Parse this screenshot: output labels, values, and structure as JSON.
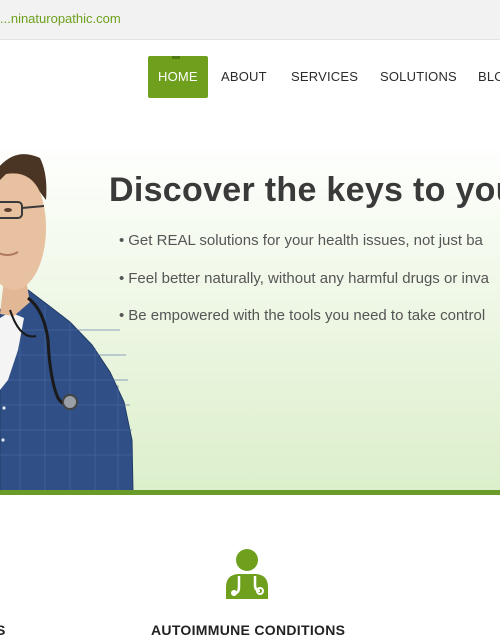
{
  "site": {
    "domain": "...ninaturopathic.com"
  },
  "nav": {
    "items": [
      {
        "label": "HOME"
      },
      {
        "label": "ABOUT"
      },
      {
        "label": "SERVICES"
      },
      {
        "label": "SOLUTIONS"
      },
      {
        "label": "BLO"
      }
    ]
  },
  "hero": {
    "title": "Discover the keys to you",
    "bullets": [
      "Get REAL solutions for your health issues, not just ba",
      "Feel better naturally, without any harmful drugs or inva",
      "Be empowered with the tools you need to take control"
    ],
    "bullet_char": "•"
  },
  "features": {
    "items": [
      {
        "title": "S"
      },
      {
        "title": "AUTOIMMUNE CONDITIONS",
        "icon": "doctor-icon"
      }
    ]
  },
  "colors": {
    "accent": "#6ea01e",
    "accent_dark": "#6a9a28",
    "heading": "#3a3a3a",
    "text": "#555555"
  }
}
